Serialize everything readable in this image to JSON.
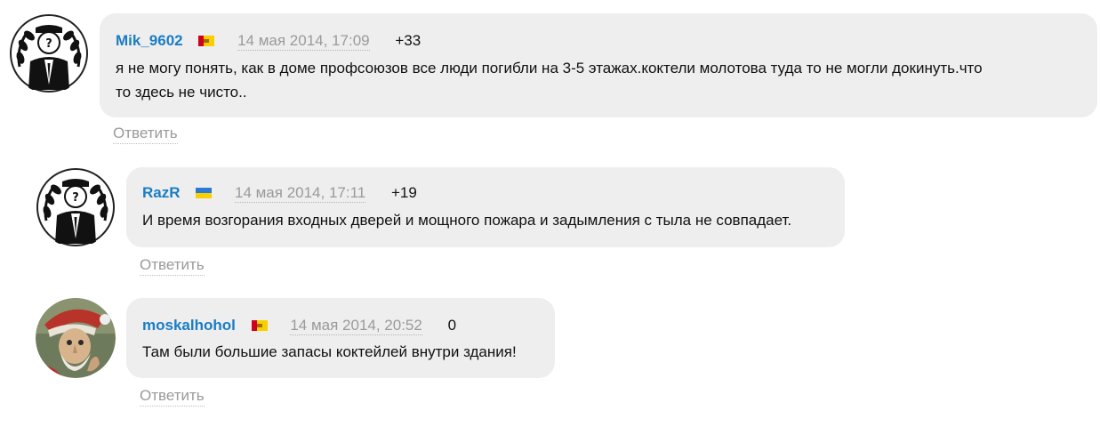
{
  "comments": [
    {
      "author": "Mik_9602",
      "flag": "moldova-flag-icon",
      "date": "14 мая 2014, 17:09",
      "score": "+33",
      "text_line1": "я не могу понять, как в доме профсоюзов все люди погибли на 3-5 этажах.коктели молотова туда то не могли докинуть.что",
      "text_line2": "то здесь не чисто..",
      "reply": "Ответить",
      "avatar": "anonymous-mask-avatar"
    },
    {
      "author": "RazR",
      "flag": "ukraine-flag-icon",
      "date": "14 мая 2014, 17:11",
      "score": "+19",
      "text_line1": "И время возгорания входных дверей и мощного пожара и задымления с тыла не совпадает.",
      "reply": "Ответить",
      "avatar": "anonymous-mask-avatar"
    },
    {
      "author": "moskalhohol",
      "flag": "moldova-flag-icon",
      "date": "14 мая 2014, 20:52",
      "score": "0",
      "text_line1": "Там были большие запасы коктейлей внутри здания!",
      "reply": "Ответить",
      "avatar": "santa-portrait-avatar"
    }
  ],
  "colors": {
    "author": "#1a7dc4",
    "bubble": "#eeeeee",
    "muted": "#9a9a9a"
  }
}
